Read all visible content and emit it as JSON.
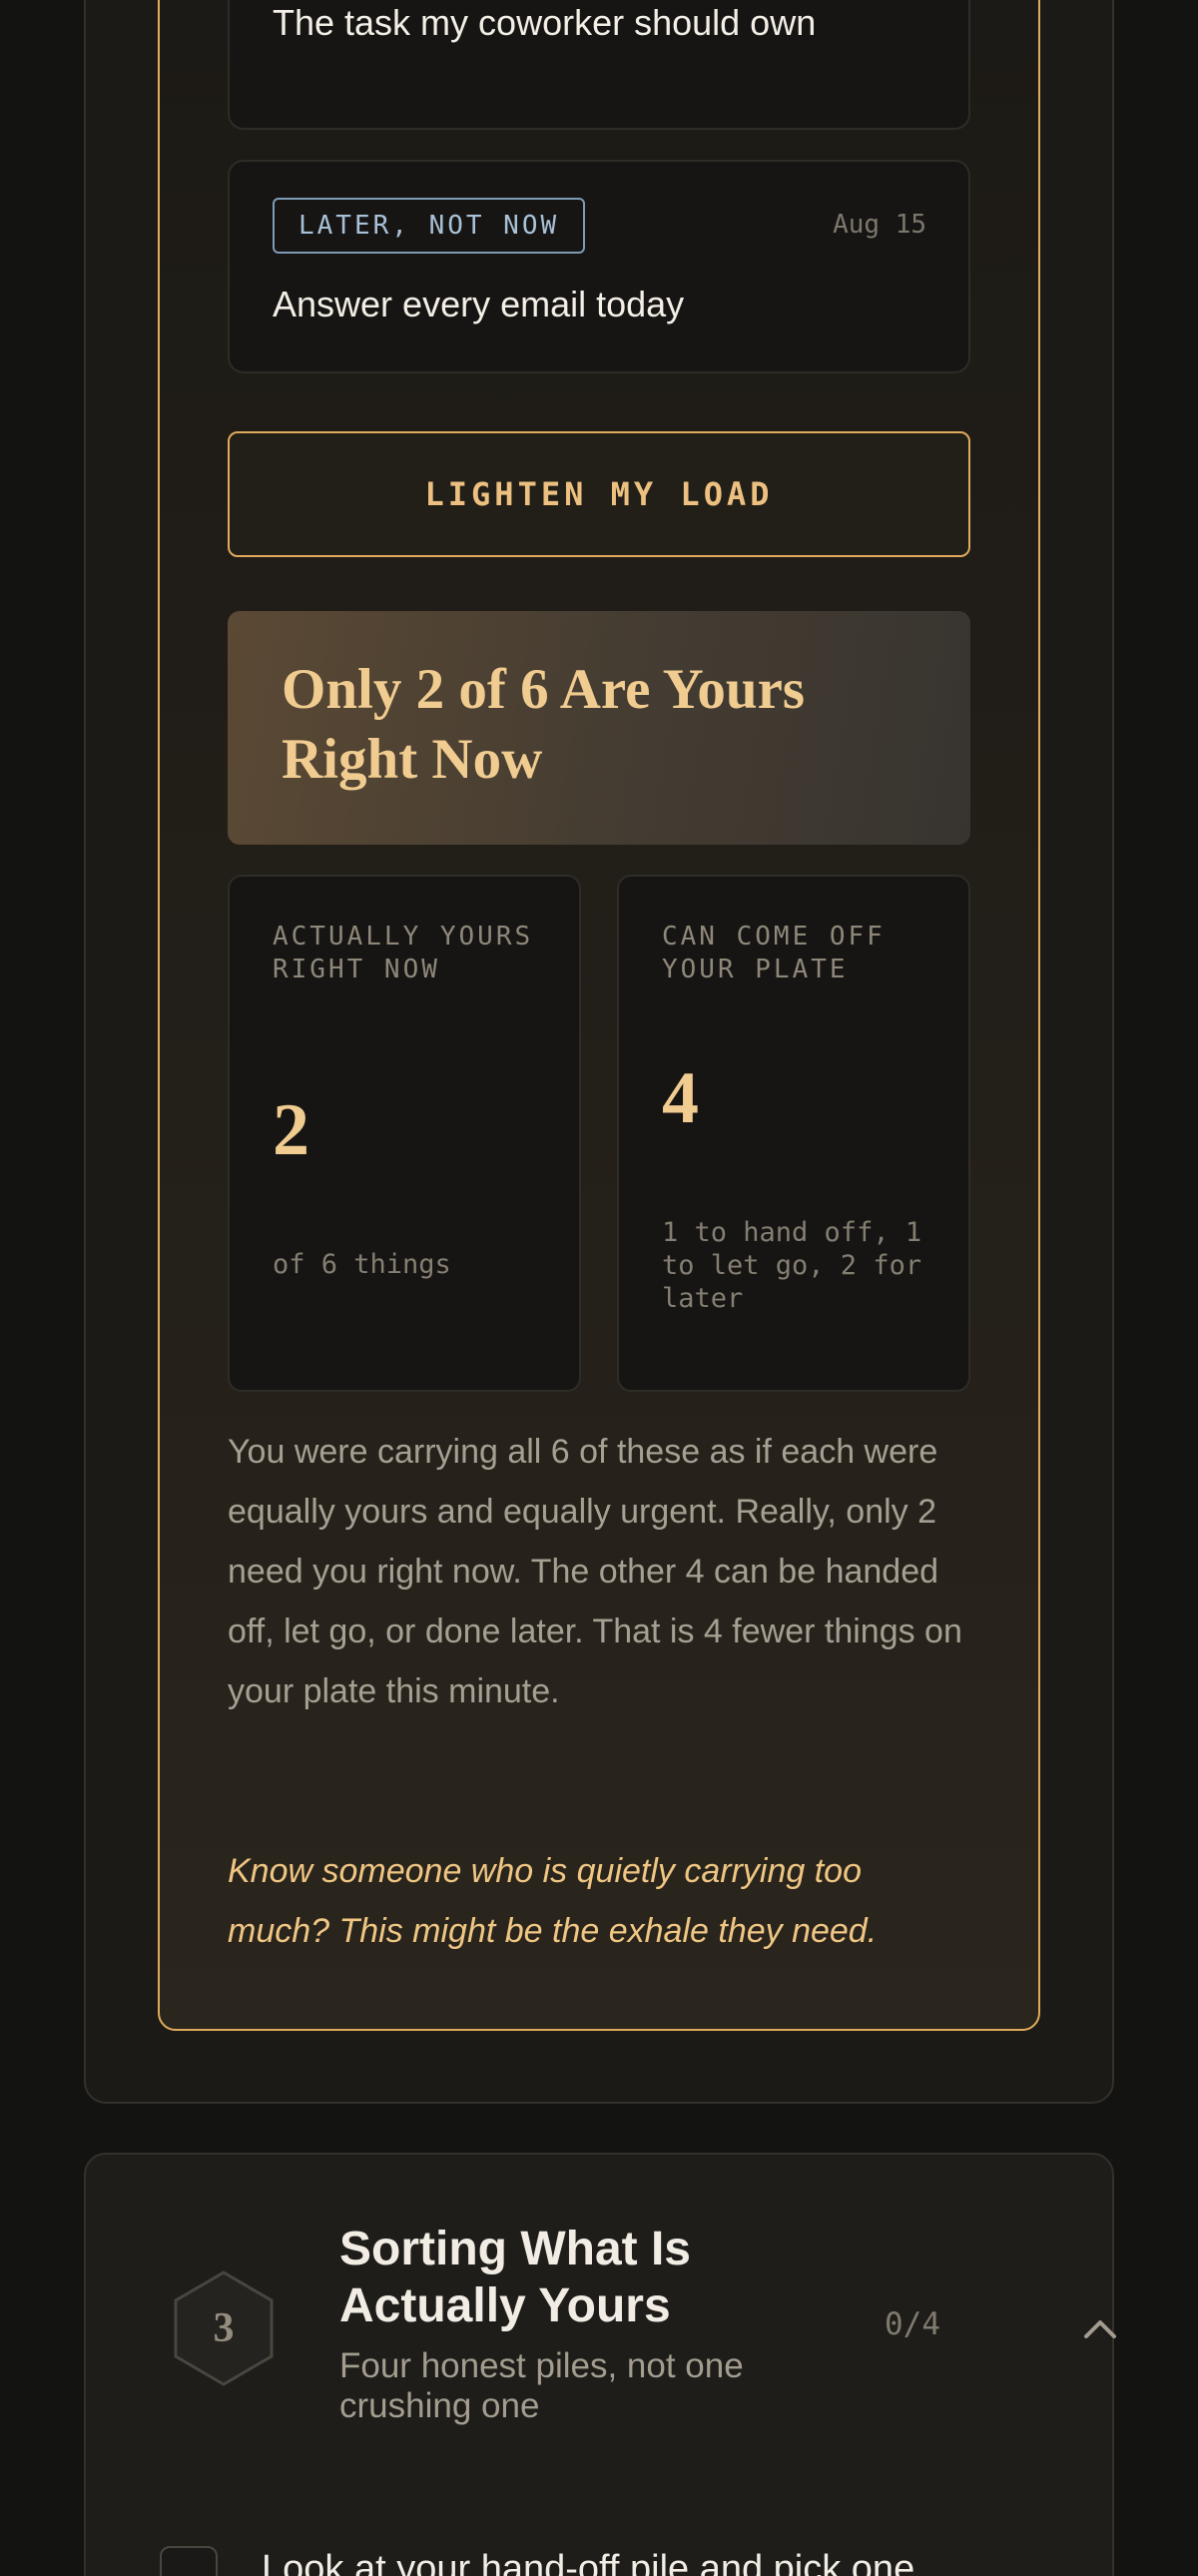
{
  "tasks": [
    {
      "tag": "",
      "date": "",
      "title": "The task my coworker should own"
    },
    {
      "tag": "LATER, NOT NOW",
      "date": "Aug 15",
      "title": "Answer every email today"
    }
  ],
  "action": {
    "label": "LIGHTEN MY LOAD"
  },
  "result": {
    "title": "Only 2 of 6 Are Yours Right Now",
    "yours": {
      "label": "ACTUALLY YOURS RIGHT NOW",
      "value": "2",
      "sub": "of 6 things"
    },
    "off_plate": {
      "label": "CAN COME OFF YOUR PLATE",
      "value": "4",
      "sub": "1 to hand off, 1 to let go, 2 for later"
    },
    "summary": "You were carrying all 6 of these as if each were equally yours and equally urgent. Really, only 2 need you right now. The other 4 can be handed off, let go, or done later. That is 4 fewer things on your plate this minute.",
    "share_note": "Know someone who is quietly carrying too much? This might be the exhale they need."
  },
  "section": {
    "step": "3",
    "title": "Sorting What Is Actually Yours",
    "subtitle": "Four honest piles, not one crushing one",
    "progress": "0/4",
    "toggle_icon": "chevron-up-icon",
    "items": [
      {
        "text": "Look at your hand-off pile and pick one",
        "checked": false
      }
    ]
  },
  "colors": {
    "accent": "#e0aa5c",
    "accent_text": "#f1cc91",
    "tag_blue": "#7f9bb6",
    "background": "#131311"
  }
}
